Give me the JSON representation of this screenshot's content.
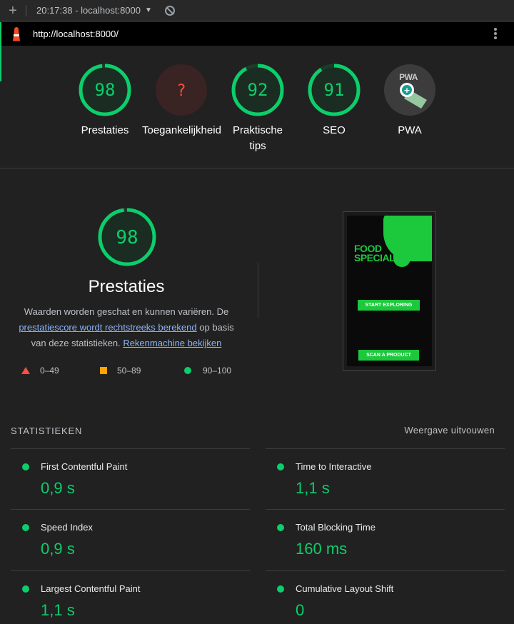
{
  "toolbar": {
    "report_label": "20:17:38 - localhost:8000"
  },
  "url_bar": {
    "url": "http://localhost:8000/"
  },
  "categories": [
    {
      "label": "Prestaties",
      "score": "98",
      "status": "pass",
      "fraction": 0.98
    },
    {
      "label": "Toegankelijkheid",
      "score": "?",
      "status": "error",
      "fraction": 0
    },
    {
      "label": "Praktische tips",
      "score": "92",
      "status": "pass",
      "fraction": 0.92
    },
    {
      "label": "SEO",
      "score": "91",
      "status": "pass",
      "fraction": 0.91
    },
    {
      "label": "PWA",
      "badge": "PWA",
      "status": "pwa"
    }
  ],
  "performance": {
    "score": "98",
    "fraction": 0.98,
    "title": "Prestaties",
    "desc_part1": "Waarden worden geschat en kunnen variëren. De",
    "desc_link1": "prestatiescore wordt rechtstreeks berekend",
    "desc_part2": "op basis van deze statistieken.",
    "desc_link2": "Rekenmachine bekijken"
  },
  "legend": {
    "fail": "0–49",
    "average": "50–89",
    "pass": "90–100"
  },
  "screenshot": {
    "title_line1": "FOOD",
    "title_line2": "SPECIALIST",
    "button1": "START EXPLORING",
    "button2": "SCAN A PRODUCT"
  },
  "stats": {
    "heading": "STATISTIEKEN",
    "toggle": "Weergave uitvouwen",
    "metrics": [
      {
        "name": "First Contentful Paint",
        "value": "0,9 s"
      },
      {
        "name": "Time to Interactive",
        "value": "1,1 s"
      },
      {
        "name": "Speed Index",
        "value": "0,9 s"
      },
      {
        "name": "Total Blocking Time",
        "value": "160 ms"
      },
      {
        "name": "Largest Contentful Paint",
        "value": "1,1 s"
      },
      {
        "name": "Cumulative Layout Shift",
        "value": "0"
      }
    ]
  },
  "colors": {
    "pass": "#0cce6b",
    "fail": "#ff4e42",
    "average": "#ffa400"
  }
}
